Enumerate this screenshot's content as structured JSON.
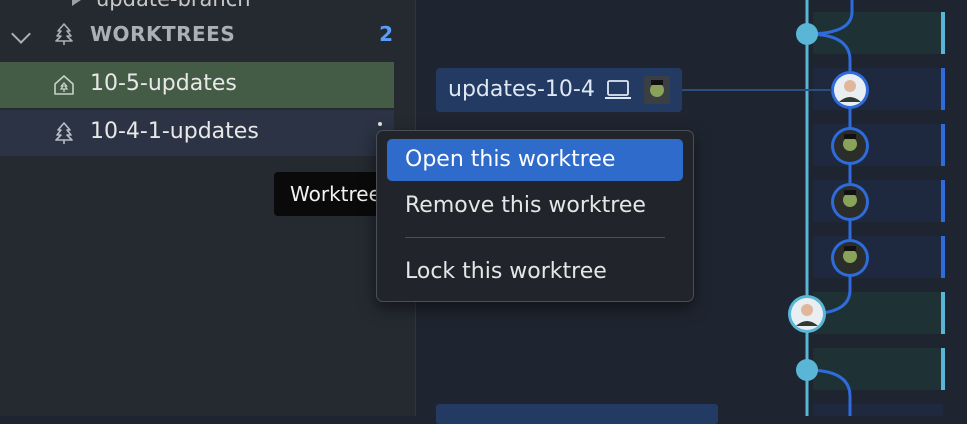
{
  "sidebar": {
    "top_cut_text": "update-branch",
    "section": {
      "title": "WORKTREES",
      "count": "2"
    },
    "worktrees": [
      {
        "label": "10-5-updates",
        "icon": "home-tree-icon"
      },
      {
        "label": "10-4-1-updates",
        "icon": "tree-icon"
      }
    ]
  },
  "tooltip": {
    "text": "Worktree"
  },
  "context_menu": {
    "items": [
      {
        "label": "Open this worktree",
        "selected": true
      },
      {
        "label": "Remove this worktree",
        "selected": false
      },
      {
        "label": "Lock this worktree",
        "selected": false
      }
    ]
  },
  "graph": {
    "branch_chip": {
      "name": "updates-10-4",
      "icons": [
        "laptop-icon",
        "avatar-icon"
      ]
    },
    "colors": {
      "lane": "#5ab6d6",
      "accent": "#2f6bdb",
      "row_teal": "#1e3236",
      "row_blue": "#1e2940"
    }
  }
}
